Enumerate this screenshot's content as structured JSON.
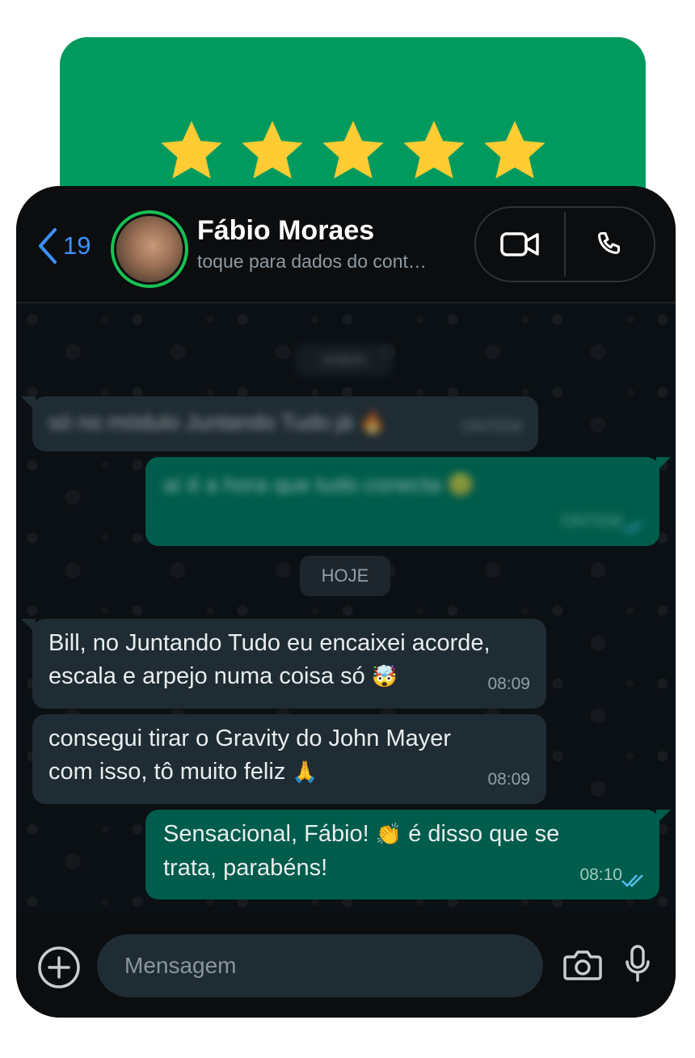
{
  "rating": {
    "stars": 5,
    "max": 5,
    "star_color": "#ffcc33",
    "card_color": "#009a5e"
  },
  "header": {
    "back_count": "19",
    "contact_name": "Fábio Moraes",
    "contact_subtitle": "toque para dados do cont…",
    "icons": [
      "chevron-left-icon",
      "video-call-icon",
      "phone-icon"
    ],
    "accent": "#3b91ff",
    "status_ring": "#19c052"
  },
  "chat": {
    "blurred_date": "ontem",
    "blurred_in": {
      "text": "só no módulo Juntando Tudo já 🔥",
      "time": "ONTEM"
    },
    "blurred_out": {
      "text": "aí é a hora que tudo conecta 😊",
      "time": "ONTEM"
    },
    "date_chip": "HOJE",
    "messages": [
      {
        "direction": "in",
        "line1": "Bill, no Juntando Tudo eu encaixei acorde,",
        "line2": "escala e arpejo numa coisa só",
        "emoji": "🤯",
        "time": "08:09"
      },
      {
        "direction": "in",
        "line1": "consegui tirar o Gravity do John Mayer",
        "line2": "com isso, tô muito feliz",
        "emoji": "🙏",
        "time": "08:09"
      },
      {
        "direction": "out",
        "line1a": "Sensacional, Fábio!",
        "emoji": "👏",
        "line1b": "é disso que se",
        "line2": "trata, parabéns!",
        "time": "08:10",
        "read": true
      }
    ],
    "bubble_in_color": "#1f2c33",
    "bubble_out_color": "#005c4b"
  },
  "footer": {
    "placeholder": "Mensagem",
    "icons": [
      "plus-icon",
      "camera-icon",
      "microphone-icon"
    ]
  }
}
